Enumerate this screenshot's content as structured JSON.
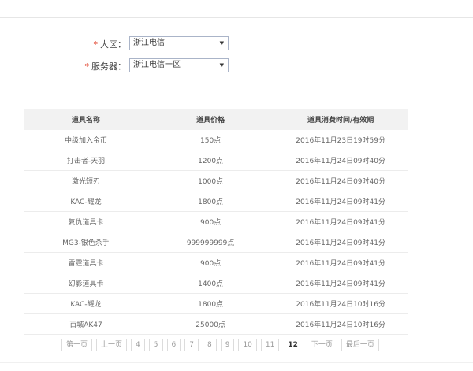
{
  "form": {
    "region": {
      "required_mark": "*",
      "label": "大区：",
      "value": "浙江电信"
    },
    "server": {
      "required_mark": "*",
      "label": "服务器：",
      "value": "浙江电信一区"
    }
  },
  "table": {
    "headers": [
      "道具名称",
      "道具价格",
      "道具消费时间/有效期"
    ],
    "rows": [
      [
        "中级加入金币",
        "150点",
        "2016年11月23日19时59分"
      ],
      [
        "打击者-天羽",
        "1200点",
        "2016年11月24日09时40分"
      ],
      [
        "激光短刃",
        "1000点",
        "2016年11月24日09时40分"
      ],
      [
        "KAC-耀龙",
        "1800点",
        "2016年11月24日09时41分"
      ],
      [
        "复仇道具卡",
        "900点",
        "2016年11月24日09时41分"
      ],
      [
        "MG3-银色杀手",
        "999999999点",
        "2016年11月24日09时41分"
      ],
      [
        "雷霆道具卡",
        "900点",
        "2016年11月24日09时41分"
      ],
      [
        "幻影道具卡",
        "1400点",
        "2016年11月24日09时41分"
      ],
      [
        "KAC-耀龙",
        "1800点",
        "2016年11月24日10时16分"
      ],
      [
        "百城AK47",
        "25000点",
        "2016年11月24日10时16分"
      ]
    ]
  },
  "pagination": {
    "first": "第一页",
    "prev": "上一页",
    "pages": [
      "4",
      "5",
      "6",
      "7",
      "8",
      "9",
      "10",
      "11"
    ],
    "current": "12",
    "next": "下一页",
    "last": "最后一页"
  },
  "icons": {
    "dropdown": "chevron-down-icon"
  }
}
